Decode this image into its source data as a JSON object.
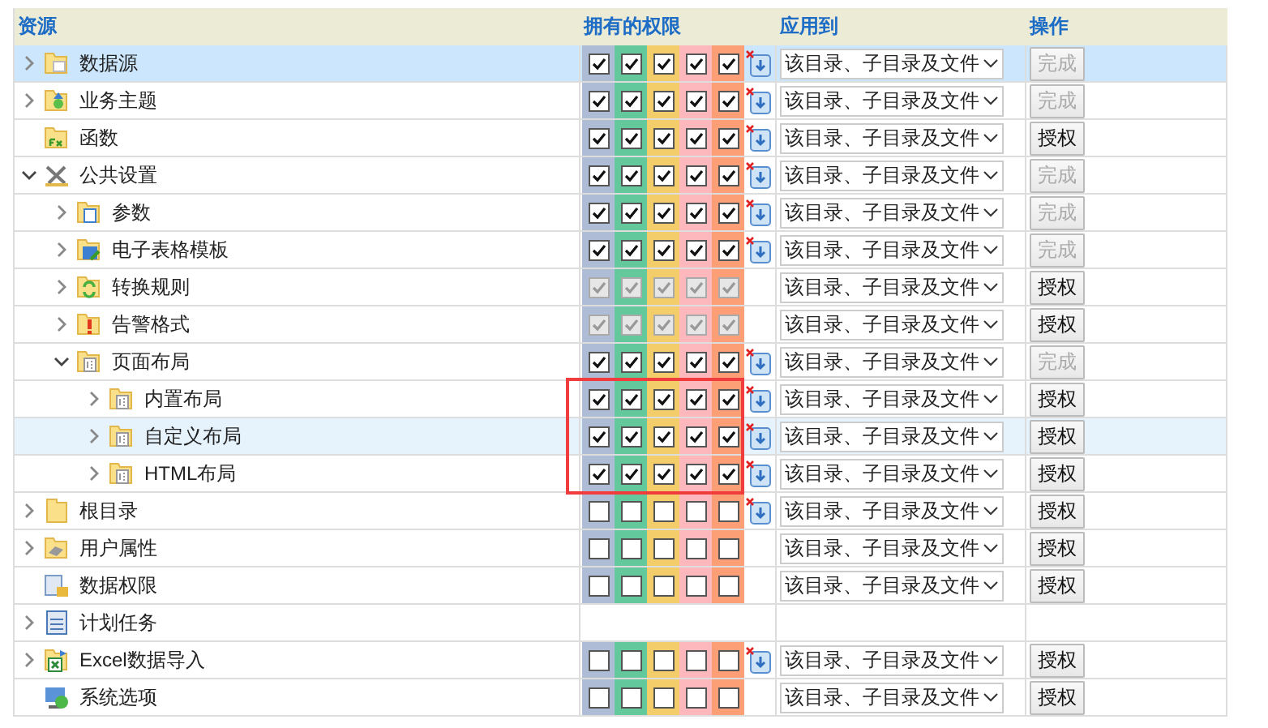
{
  "columns": [
    "资源",
    "拥有的权限",
    "应用到",
    "操作"
  ],
  "tree": [
    {
      "name": "数据源",
      "kind": "datasource",
      "expandable": true,
      "expanded": false,
      "selected": true,
      "hovered": false,
      "clear_icon": true,
      "permissions_disabled": false,
      "permissions": [
        {
          "checked": true
        },
        {
          "checked": true
        },
        {
          "checked": true
        },
        {
          "checked": true
        },
        {
          "checked": true
        }
      ],
      "apply_to": "该目录、子目录及文件",
      "action": {
        "label": "完成",
        "disabled": true
      }
    },
    {
      "name": "业务主题",
      "kind": "topic",
      "expandable": true,
      "expanded": false,
      "selected": false,
      "hovered": false,
      "clear_icon": true,
      "permissions_disabled": false,
      "permissions": [
        {
          "checked": true
        },
        {
          "checked": true
        },
        {
          "checked": true
        },
        {
          "checked": true
        },
        {
          "checked": true
        }
      ],
      "apply_to": "该目录、子目录及文件",
      "action": {
        "label": "完成",
        "disabled": true
      }
    },
    {
      "name": "函数",
      "kind": "function",
      "selected": false,
      "hovered": false,
      "clear_icon": true,
      "permissions_disabled": false,
      "permissions": [
        {
          "checked": true
        },
        {
          "checked": true
        },
        {
          "checked": true
        },
        {
          "checked": true
        },
        {
          "checked": true
        }
      ],
      "apply_to": "该目录、子目录及文件",
      "action": {
        "label": "授权",
        "disabled": false
      }
    },
    {
      "name": "公共设置",
      "kind": "tools",
      "expandable": true,
      "expanded": true,
      "selected": false,
      "hovered": false,
      "clear_icon": true,
      "permissions_disabled": false,
      "permissions": [
        {
          "checked": true
        },
        {
          "checked": true
        },
        {
          "checked": true
        },
        {
          "checked": true
        },
        {
          "checked": true
        }
      ],
      "apply_to": "该目录、子目录及文件",
      "action": {
        "label": "完成",
        "disabled": true
      },
      "children": [
        {
          "name": "参数",
          "kind": "param",
          "expandable": true,
          "expanded": false,
          "selected": false,
          "hovered": false,
          "clear_icon": true,
          "permissions_disabled": false,
          "permissions": [
            {
              "checked": true
            },
            {
              "checked": true
            },
            {
              "checked": true
            },
            {
              "checked": true
            },
            {
              "checked": true
            }
          ],
          "apply_to": "该目录、子目录及文件",
          "action": {
            "label": "完成",
            "disabled": true
          }
        },
        {
          "name": "电子表格模板",
          "kind": "sheet",
          "expandable": true,
          "expanded": false,
          "selected": false,
          "hovered": false,
          "clear_icon": true,
          "permissions_disabled": false,
          "permissions": [
            {
              "checked": true
            },
            {
              "checked": true
            },
            {
              "checked": true
            },
            {
              "checked": true
            },
            {
              "checked": true
            }
          ],
          "apply_to": "该目录、子目录及文件",
          "action": {
            "label": "完成",
            "disabled": true
          }
        },
        {
          "name": "转换规则",
          "kind": "convert",
          "expandable": true,
          "expanded": false,
          "selected": false,
          "hovered": false,
          "permissions_disabled": true,
          "permissions": [
            {
              "checked": true
            },
            {
              "checked": true
            },
            {
              "checked": true
            },
            {
              "checked": true
            },
            {
              "checked": true
            }
          ],
          "apply_to": "该目录、子目录及文件",
          "action": {
            "label": "授权",
            "disabled": false
          }
        },
        {
          "name": "告警格式",
          "kind": "alert",
          "expandable": true,
          "expanded": false,
          "selected": false,
          "hovered": false,
          "permissions_disabled": true,
          "permissions": [
            {
              "checked": true
            },
            {
              "checked": true
            },
            {
              "checked": true
            },
            {
              "checked": true
            },
            {
              "checked": true
            }
          ],
          "apply_to": "该目录、子目录及文件",
          "action": {
            "label": "授权",
            "disabled": false
          }
        },
        {
          "name": "页面布局",
          "kind": "layout",
          "expandable": true,
          "expanded": true,
          "selected": false,
          "hovered": false,
          "clear_icon": true,
          "permissions_disabled": false,
          "permissions": [
            {
              "checked": true
            },
            {
              "checked": true
            },
            {
              "checked": true
            },
            {
              "checked": true
            },
            {
              "checked": true
            }
          ],
          "apply_to": "该目录、子目录及文件",
          "action": {
            "label": "完成",
            "disabled": true
          },
          "children": [
            {
              "name": "内置布局",
              "kind": "layout",
              "expandable": true,
              "expanded": false,
              "selected": false,
              "hovered": false,
              "boxed": true,
              "clear_icon": true,
              "permissions_disabled": false,
              "permissions": [
                {
                  "checked": true
                },
                {
                  "checked": true
                },
                {
                  "checked": true
                },
                {
                  "checked": true
                },
                {
                  "checked": true
                }
              ],
              "apply_to": "该目录、子目录及文件",
              "action": {
                "label": "授权",
                "disabled": false
              }
            },
            {
              "name": "自定义布局",
              "kind": "layout",
              "expandable": true,
              "expanded": false,
              "selected": false,
              "hovered": true,
              "boxed": true,
              "clear_icon": true,
              "permissions_disabled": false,
              "permissions": [
                {
                  "checked": true
                },
                {
                  "checked": true
                },
                {
                  "checked": true
                },
                {
                  "checked": true
                },
                {
                  "checked": true
                }
              ],
              "apply_to": "该目录、子目录及文件",
              "action": {
                "label": "授权",
                "disabled": false
              }
            },
            {
              "name": "HTML布局",
              "kind": "layout",
              "expandable": true,
              "expanded": false,
              "selected": false,
              "hovered": false,
              "boxed": true,
              "clear_icon": true,
              "permissions_disabled": false,
              "permissions": [
                {
                  "checked": true
                },
                {
                  "checked": true
                },
                {
                  "checked": true
                },
                {
                  "checked": true
                },
                {
                  "checked": true
                }
              ],
              "apply_to": "该目录、子目录及文件",
              "action": {
                "label": "授权",
                "disabled": false
              }
            }
          ]
        }
      ]
    },
    {
      "name": "根目录",
      "kind": "folder",
      "expandable": true,
      "expanded": false,
      "selected": false,
      "hovered": false,
      "clear_icon": true,
      "permissions_disabled": false,
      "permissions": [
        {
          "checked": false
        },
        {
          "checked": false
        },
        {
          "checked": false
        },
        {
          "checked": false
        },
        {
          "checked": false
        }
      ],
      "apply_to": "该目录、子目录及文件",
      "action": {
        "label": "授权",
        "disabled": false
      }
    },
    {
      "name": "用户属性",
      "kind": "userprop",
      "expandable": true,
      "expanded": false,
      "selected": false,
      "hovered": false,
      "permissions_disabled": false,
      "permissions": [
        {
          "checked": false
        },
        {
          "checked": false
        },
        {
          "checked": false
        },
        {
          "checked": false
        },
        {
          "checked": false
        }
      ],
      "apply_to": "该目录、子目录及文件",
      "action": {
        "label": "授权",
        "disabled": false
      }
    },
    {
      "name": "数据权限",
      "kind": "datalock",
      "selected": false,
      "hovered": false,
      "permissions_disabled": false,
      "permissions": [
        {
          "checked": false
        },
        {
          "checked": false
        },
        {
          "checked": false
        },
        {
          "checked": false
        },
        {
          "checked": false
        }
      ],
      "apply_to": "该目录、子目录及文件",
      "action": {
        "label": "授权",
        "disabled": false
      }
    },
    {
      "name": "计划任务",
      "kind": "schedule",
      "expandable": true,
      "expanded": false,
      "selected": false,
      "hovered": false
    },
    {
      "name": "Excel数据导入",
      "kind": "excel",
      "expandable": true,
      "expanded": false,
      "selected": false,
      "hovered": false,
      "clear_icon": true,
      "permissions_disabled": false,
      "permissions": [
        {
          "checked": false
        },
        {
          "checked": false
        },
        {
          "checked": false
        },
        {
          "checked": false
        },
        {
          "checked": false
        }
      ],
      "apply_to": "该目录、子目录及文件",
      "action": {
        "label": "授权",
        "disabled": false
      }
    },
    {
      "name": "系统选项",
      "kind": "system",
      "selected": false,
      "hovered": false,
      "permissions_disabled": false,
      "permissions": [
        {
          "checked": false
        },
        {
          "checked": false
        },
        {
          "checked": false
        },
        {
          "checked": false
        },
        {
          "checked": false
        }
      ],
      "apply_to": "该目录、子目录及文件",
      "action": {
        "label": "授权",
        "disabled": false
      }
    }
  ]
}
